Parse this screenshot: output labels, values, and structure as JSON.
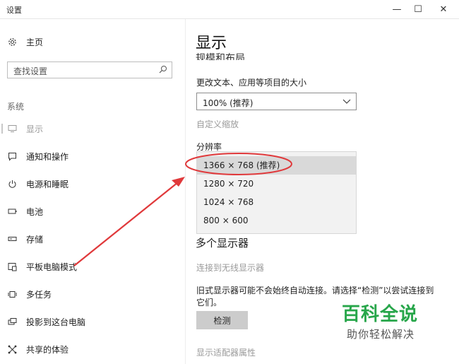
{
  "window": {
    "title": "设置",
    "min_glyph": "—",
    "max_glyph": "☐",
    "close_glyph": "✕"
  },
  "sidebar": {
    "home_label": "主页",
    "search_placeholder": "查找设置",
    "section_label": "系统",
    "items": [
      {
        "label": "显示",
        "icon": "monitor-icon"
      },
      {
        "label": "通知和操作",
        "icon": "notification-icon"
      },
      {
        "label": "电源和睡眠",
        "icon": "power-icon"
      },
      {
        "label": "电池",
        "icon": "battery-icon"
      },
      {
        "label": "存储",
        "icon": "storage-icon"
      },
      {
        "label": "平板电脑模式",
        "icon": "tablet-mode-icon"
      },
      {
        "label": "多任务",
        "icon": "multitask-icon"
      },
      {
        "label": "投影到这台电脑",
        "icon": "project-icon"
      },
      {
        "label": "共享的体验",
        "icon": "share-icon"
      }
    ]
  },
  "main": {
    "title": "显示",
    "partial_heading": "规模和布局",
    "scale_label": "更改文本、应用等项目的大小",
    "scale_value": "100% (推荐)",
    "custom_scale": "自定义缩放",
    "resolution_label": "分辨率",
    "resolution_options": [
      "1366 × 768 (推荐)",
      "1280 × 720",
      "1024 × 768",
      "800 × 600"
    ],
    "multi_display_heading": "多个显示器",
    "wireless_link": "连接到无线显示器",
    "old_display_text_line1": "旧式显示器可能不会始终自动连接。请选择“检测”以尝试连接到",
    "old_display_text_line2": "它们。",
    "detect_button": "检测",
    "adapter_link": "显示适配器属性"
  },
  "watermark": {
    "big": "百科全说",
    "small": "助你轻松解决"
  },
  "colors": {
    "annotation_red": "#e0393b",
    "watermark_green": "#27a64a",
    "selected_option": "#d9d9d9"
  }
}
